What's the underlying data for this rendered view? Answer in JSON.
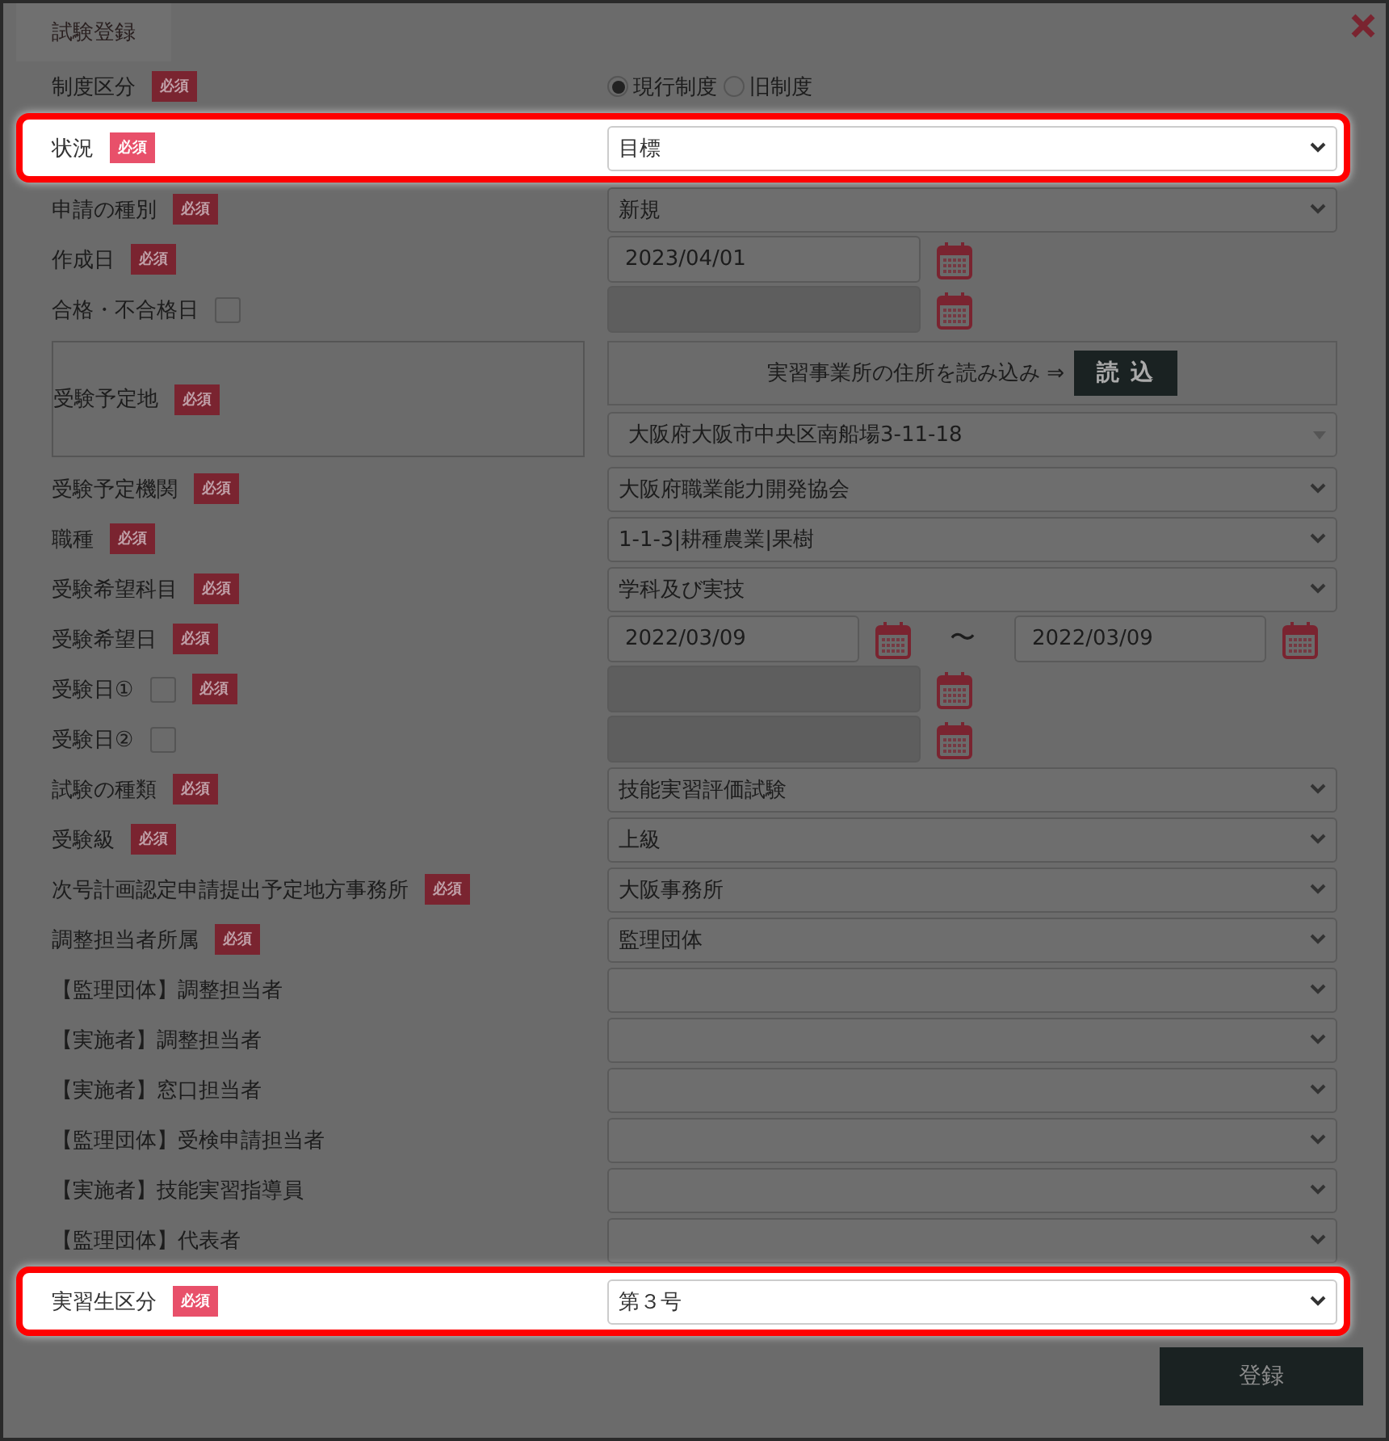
{
  "dialog": {
    "title": "試験登録",
    "submit": "登録"
  },
  "rows": [
    {
      "label": "制度区分",
      "badge": "必須",
      "kind": "radio",
      "highlighted": false,
      "options": [
        {
          "label": "現行制度",
          "selected": true
        },
        {
          "label": "旧制度",
          "selected": false
        }
      ]
    },
    {
      "label": "状況",
      "badge": "必須",
      "kind": "select",
      "highlighted": true,
      "value": "目標"
    },
    {
      "label": "申請の種別",
      "badge": "必須",
      "kind": "select",
      "highlighted": false,
      "value": "新規"
    },
    {
      "label": "作成日",
      "badge": "必須",
      "kind": "date",
      "highlighted": false,
      "disabled": false,
      "value": "2023/04/01"
    },
    {
      "label": "合格・不合格日",
      "kind": "date",
      "highlighted": false,
      "checkbox": {
        "checked": false
      },
      "disabled": true
    },
    {
      "label": "受験予定地",
      "badge": "必須",
      "kind": "address",
      "highlighted": false,
      "prompt": "実習事業所の住所を読み込み ⇒",
      "button": "読 込",
      "value": "大阪府大阪市中央区南船場3-11-18"
    },
    {
      "label": "受験予定機関",
      "badge": "必須",
      "kind": "select",
      "highlighted": false,
      "value": "大阪府職業能力開発協会"
    },
    {
      "label": "職種",
      "badge": "必須",
      "kind": "select",
      "highlighted": false,
      "value": "1-1-3|耕種農業|果樹"
    },
    {
      "label": "受験希望科目",
      "badge": "必須",
      "kind": "select",
      "highlighted": false,
      "value": "学科及び実技"
    },
    {
      "label": "受験希望日",
      "badge": "必須",
      "kind": "date_range",
      "highlighted": false,
      "from": "2022/03/09",
      "separator": "〜",
      "to": "2022/03/09"
    },
    {
      "label": "受験日①",
      "badge": "必須",
      "kind": "date",
      "highlighted": false,
      "checkbox": {
        "checked": false
      },
      "disabled": true
    },
    {
      "label": "受験日②",
      "kind": "date",
      "highlighted": false,
      "checkbox": {
        "checked": false
      },
      "disabled": true
    },
    {
      "label": "試験の種類",
      "badge": "必須",
      "kind": "select",
      "highlighted": false,
      "value": "技能実習評価試験"
    },
    {
      "label": "受験級",
      "badge": "必須",
      "kind": "select",
      "highlighted": false,
      "value": "上級"
    },
    {
      "label": "次号計画認定申請提出予定地方事務所",
      "badge": "必須",
      "kind": "select",
      "highlighted": false,
      "value": "大阪事務所"
    },
    {
      "label": "調整担当者所属",
      "badge": "必須",
      "kind": "select",
      "highlighted": false,
      "value": "監理団体"
    },
    {
      "label": "【監理団体】調整担当者",
      "kind": "select",
      "highlighted": false
    },
    {
      "label": "【実施者】調整担当者",
      "kind": "select",
      "highlighted": false
    },
    {
      "label": "【実施者】窓口担当者",
      "kind": "select",
      "highlighted": false
    },
    {
      "label": "【監理団体】受検申請担当者",
      "kind": "select",
      "highlighted": false
    },
    {
      "label": "【実施者】技能実習指導員",
      "kind": "select",
      "highlighted": false
    },
    {
      "label": "【監理団体】代表者",
      "kind": "select",
      "highlighted": false
    },
    {
      "label": "実習生区分",
      "badge": "必須",
      "kind": "select",
      "highlighted": true,
      "value": "第３号"
    }
  ]
}
